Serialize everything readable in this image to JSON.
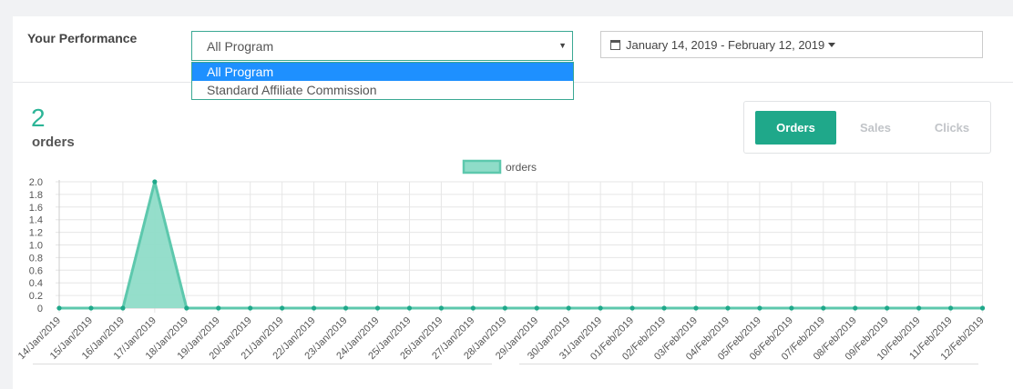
{
  "header": {
    "title": "Your Performance",
    "program_select": {
      "value": "All Program",
      "options": [
        "All Program",
        "Standard Affiliate Commission"
      ]
    },
    "date_range": "January 14, 2019 - February 12, 2019"
  },
  "metric": {
    "value": "2",
    "label": "orders"
  },
  "tabs": [
    {
      "label": "Orders",
      "active": true
    },
    {
      "label": "Sales",
      "active": false
    },
    {
      "label": "Clicks",
      "active": false
    }
  ],
  "colors": {
    "accent": "#1fa88a",
    "series_line": "#5dc8ad",
    "series_fill": "#8fdcc8",
    "selected_option": "#1e90ff"
  },
  "chart_data": {
    "type": "area",
    "legend": "top-center",
    "grid": true,
    "ylim": [
      0,
      2.0
    ],
    "yticks": [
      "0",
      "0.2",
      "0.4",
      "0.6",
      "0.8",
      "1.0",
      "1.2",
      "1.4",
      "1.6",
      "1.8",
      "2.0"
    ],
    "categories": [
      "14/Jan/2019",
      "15/Jan/2019",
      "16/Jan/2019",
      "17/Jan/2019",
      "18/Jan/2019",
      "19/Jan/2019",
      "20/Jan/2019",
      "21/Jan/2019",
      "22/Jan/2019",
      "23/Jan/2019",
      "24/Jan/2019",
      "25/Jan/2019",
      "26/Jan/2019",
      "27/Jan/2019",
      "28/Jan/2019",
      "29/Jan/2019",
      "30/Jan/2019",
      "31/Jan/2019",
      "01/Feb/2019",
      "02/Feb/2019",
      "03/Feb/2019",
      "04/Feb/2019",
      "05/Feb/2019",
      "06/Feb/2019",
      "07/Feb/2019",
      "08/Feb/2019",
      "09/Feb/2019",
      "10/Feb/2019",
      "11/Feb/2019",
      "12/Feb/2019"
    ],
    "series": [
      {
        "name": "orders",
        "values": [
          0,
          0,
          0,
          2,
          0,
          0,
          0,
          0,
          0,
          0,
          0,
          0,
          0,
          0,
          0,
          0,
          0,
          0,
          0,
          0,
          0,
          0,
          0,
          0,
          0,
          0,
          0,
          0,
          0,
          0
        ]
      }
    ]
  }
}
